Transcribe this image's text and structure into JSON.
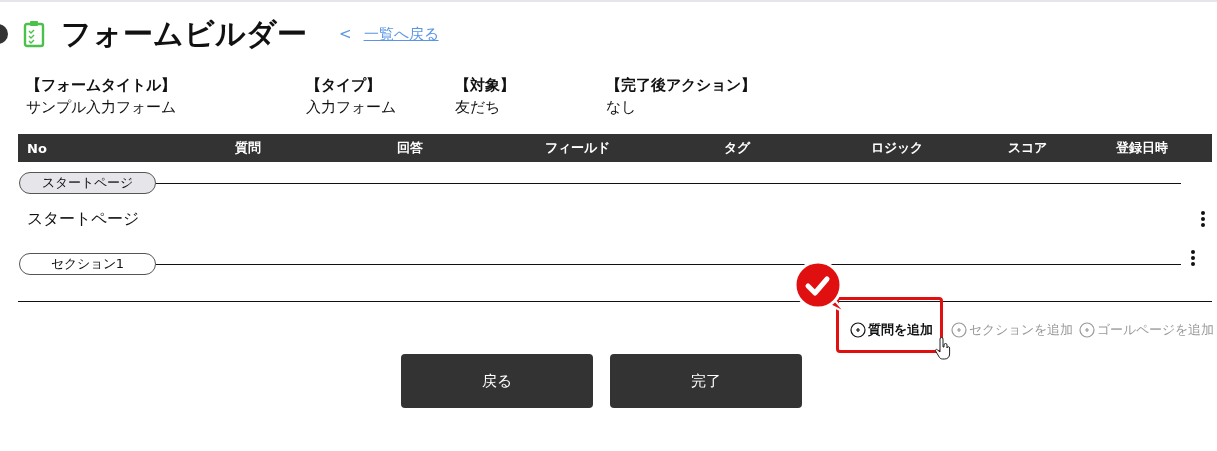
{
  "header": {
    "title": "フォームビルダー",
    "back_link": "一覧へ戻る",
    "back_arrow": "<"
  },
  "info": [
    {
      "label": "【フォームタイトル】",
      "value": "サンプル入力フォーム"
    },
    {
      "label": "【タイプ】",
      "value": "入力フォーム"
    },
    {
      "label": "【対象】",
      "value": "友だち"
    },
    {
      "label": "【完了後アクション】",
      "value": "なし"
    }
  ],
  "table": {
    "columns": [
      "No",
      "質問",
      "回答",
      "フィールド",
      "タグ",
      "ロジック",
      "スコア",
      "登録日時"
    ]
  },
  "sections": [
    {
      "kind": "page",
      "label": "スタートページ",
      "selected": true,
      "rows": [
        "スタートページ"
      ]
    },
    {
      "kind": "section",
      "label": "セクション1",
      "selected": false
    }
  ],
  "add_actions": [
    {
      "label": "質問を追加",
      "highlighted": true
    },
    {
      "label": "セクションを追加",
      "highlighted": false
    },
    {
      "label": "ゴールページを追加",
      "highlighted": false
    }
  ],
  "buttons": [
    "戻る",
    "完了"
  ]
}
